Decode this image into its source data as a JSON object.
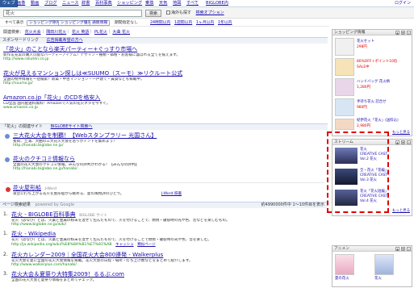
{
  "nav": {
    "tabs": [
      "ウェブ",
      "画像",
      "動画",
      "ブログ",
      "ニュース",
      "辞書",
      "百科事典",
      "ショッピング",
      "乗換",
      "天気",
      "地図",
      "すべて",
      "BIGLOBE内"
    ],
    "login": "ログイン"
  },
  "search": {
    "query": "花火",
    "button": "検索",
    "option_label": "海外も探す",
    "settings_label": "検索オプション"
  },
  "options": {
    "label": "すべて表示",
    "chips": [
      "ショッピング除外",
      "ショッピング優先",
      "通販情報"
    ],
    "period_label": "期間指定なし",
    "periods": [
      "24時間以内",
      "1週間以内",
      "1ヶ月以内",
      "1年以内"
    ]
  },
  "related": {
    "label": "関連検索：",
    "items": [
      "花火大会",
      "隅田川花火",
      "花火 英語",
      "PL花火",
      "大曲 花火"
    ]
  },
  "sponsor": {
    "label": "スポンサードリンク",
    "sub": "広告掲載希望の方へ"
  },
  "ads": [
    {
      "title": "「花火」のことなら楽天パーティー+ぐっすり市場へ",
      "desc": "新作＆充実の購入可能なパーティーアイテム！デザイン・種類・価格・お客様に喜ばれる全てを揃えます。",
      "url": "http://www.rakuten.co.jp"
    },
    {
      "title": "花火が見えるマンション探しは≪SUUMO（スーモ）≫リクルート公式",
      "desc": "全国の物件情報を一括検索！新築・中古マンション・一戸建て・賃貸なども掲載中。",
      "url": "http://suumo.jp/"
    },
    {
      "title": "Amazon.co.jp「花火」のCDを格安入",
      "desc": "CD全品 国内配送料無料！Amazonで人気の花火ネタを今すぐ。",
      "url": "www.amazon.co.jp"
    }
  ],
  "related_site": {
    "label": "「花火」の関連サイト",
    "sub": "BIGLOBEサイト検索へ"
  },
  "site_results": [
    {
      "title": "三大花火大会を制覇！【Webスタンプラリー 光国さん】",
      "desc": "長岡、土浦、大曲の三大花火大会を巡りポイントを集めよう！",
      "url": "http://hanabi.biglobe.ne.jp/"
    },
    {
      "title": "花火のクチコミ情報なら",
      "desc": "全国の花火大会のクチコミ情報。みんなの評判がわかる！【みんなの評判】",
      "url": "http://hanabi.biglobe.ne.jp/hanabi/"
    }
  ],
  "dict": {
    "title": "花火屋形船",
    "source": "J-Word",
    "desc": "夜空に打ち上がる花火を屋形船から眺める、夏の風物詩のひとつ。",
    "more": "J-Word 辞書"
  },
  "results_meta": {
    "page_label": "ページ検索結果",
    "powered": "powered by Google",
    "count": "約4990000件中 1〜10件目を表示"
  },
  "results": [
    {
      "num": "1.",
      "title": "花火 - BIGLOBE百科事典",
      "tag": "BIGLOBE サイト",
      "desc": "花火（はなび）とは、火薬と金属の粉末を混ぜて包んだもので、火を付けることで、燃焼・破裂時の光や色、音などを楽しむもの。",
      "url": "http://www.biglobe.ne.jp/wiki/"
    },
    {
      "num": "1.",
      "title": "花火 - Wikipedia",
      "tag": "",
      "desc": "花火（はなび）とは、火薬と金属の粉末を混ぜて包んだもので、火を付けることで燃焼・破裂時の光や色、音を楽しむ。",
      "url": "http://ja.wikipedia.org/wiki/%E8%8A%B1%E7%81%AB",
      "cache": "キャッシュ",
      "similar": "類似ページ"
    },
    {
      "num": "2.",
      "title": "花火カレンダー2009｜全国花火大会800連発 - Walkerplus",
      "tag": "",
      "desc": "花火大会を夏に全国の花火大会情報を掲載。花火大会の日程・場所・打ち上げ数などをまとめて紹介します。",
      "url": "http://www.walkerplus.com/hanabi/"
    },
    {
      "num": "3.",
      "title": "花火大会＆夏祭り大特集2009！るるぶ.com",
      "tag": "",
      "desc": "全国の花火大会と夏祭り情報をまとめてチェック。",
      "url": "http://www.rurubu.com/"
    }
  ],
  "shopping": {
    "title": "ショッピング情報",
    "items": [
      {
        "name": "花火セット",
        "price": "298円"
      },
      {
        "name": "80%OFF＋ポイント10倍",
        "price": "SALE中"
      },
      {
        "name": "ハンドバッグ 花火柄",
        "price": "1,280円"
      },
      {
        "name": "手持ち花火 詰合せ",
        "price": "980円"
      },
      {
        "name": "紀伊花火「花火」(送料込)",
        "price": "2,980円"
      }
    ],
    "more": "もっと見る"
  },
  "stream": {
    "title": "ストリーム",
    "items": [
      {
        "label": "花火",
        "sub": "CREATIVE CAST",
        "vol": "Vol.2 花火"
      },
      {
        "label": "全・花火「花編」",
        "sub": "CREATIVE CAST",
        "vol": "Vol.3 花火"
      },
      {
        "label": "花火「花火短編」",
        "sub": "CREATIVE CAST",
        "vol": "Vol.4 花火"
      }
    ],
    "more": "もっと見る"
  },
  "anime": {
    "title": "アニメン",
    "items": [
      {
        "name": "夏の花火",
        "sub": "花火"
      },
      {
        "name": "花火",
        "sub": "花火"
      }
    ]
  },
  "colors": {
    "nav_active": "#2e5a9c",
    "link": "#1a0dab",
    "url": "#1c8a1c",
    "dash": "#e20000"
  }
}
